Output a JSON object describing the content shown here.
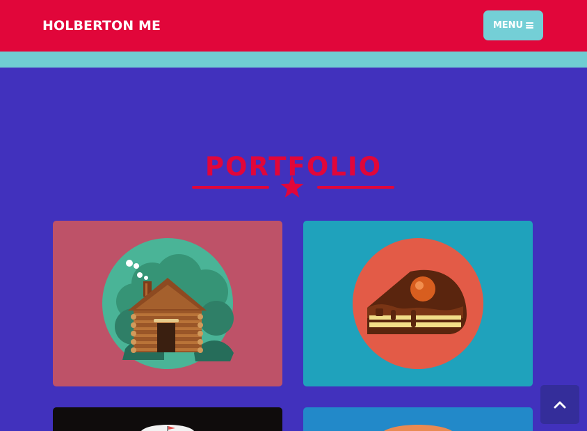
{
  "header": {
    "brand": "HOLBERTON ME",
    "menu_label": "MENU",
    "menu_icon": "hamburger-icon"
  },
  "portfolio": {
    "title": "PORTFOLIO",
    "divider_icon": "star-icon",
    "items": [
      {
        "name": "cabin",
        "icon": "cabin-icon"
      },
      {
        "name": "cake",
        "icon": "cake-icon"
      },
      {
        "name": "circus",
        "icon": "circus-tent-icon"
      },
      {
        "name": "dessert",
        "icon": "dessert-icon"
      }
    ]
  },
  "scroll_top": {
    "icon": "chevron-up-icon"
  },
  "colors": {
    "navbar": "#e1063a",
    "accent": "#e1063a",
    "teal": "#70cdd2",
    "page_background": "#4131bd",
    "card_cabin": "#be5268",
    "card_cake": "#1fa2bc",
    "card_dark": "#0f0c0c",
    "card_blue": "#2289c9",
    "scroll_top_button": "#342d9a"
  }
}
